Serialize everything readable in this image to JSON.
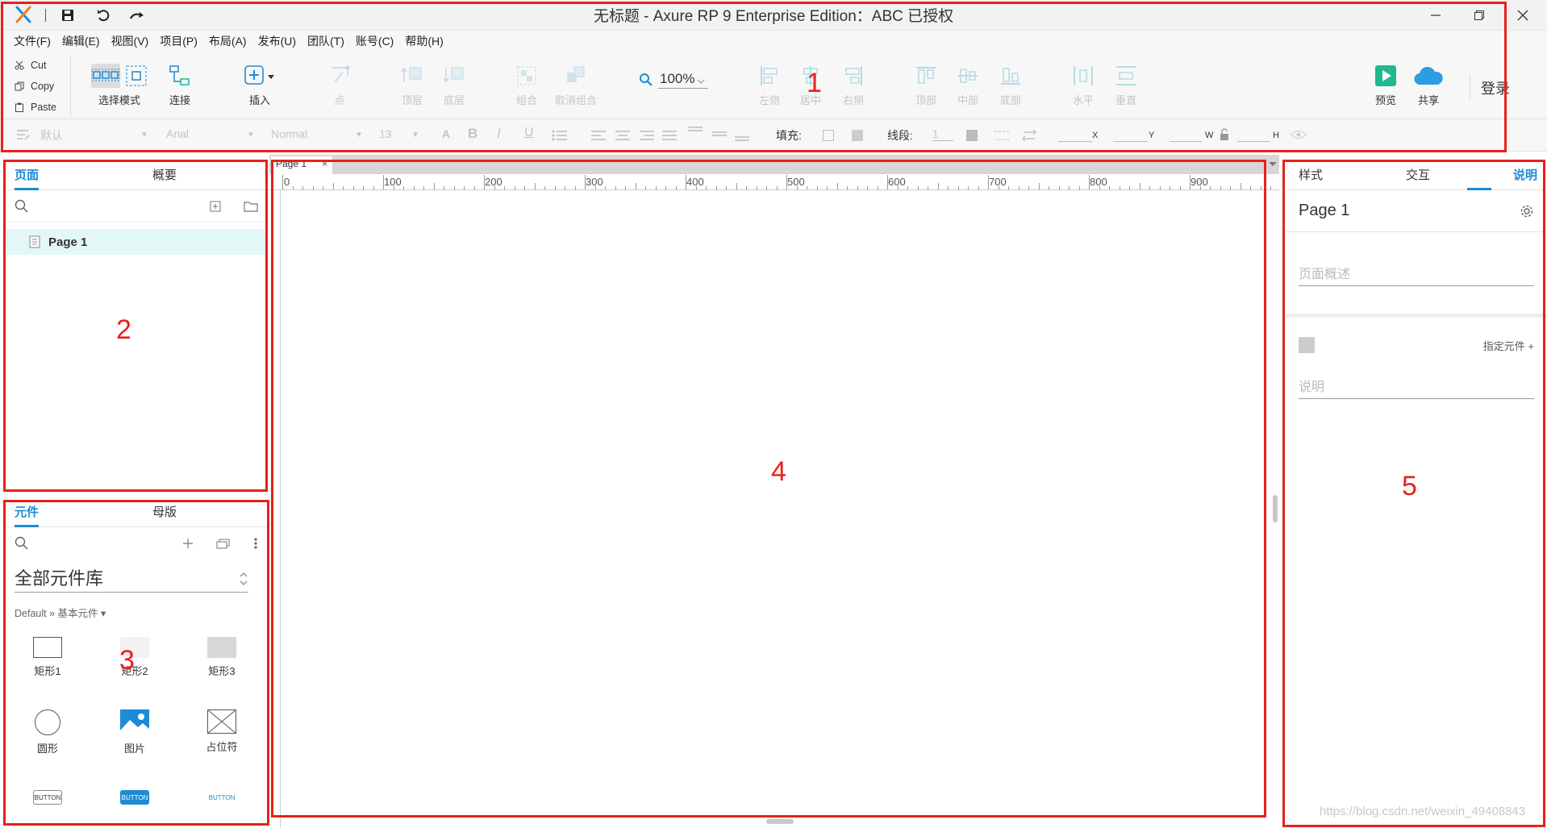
{
  "window": {
    "title": "无标题 - Axure RP 9 Enterprise Edition：ABC 已授权"
  },
  "menu": [
    "文件(F)",
    "编辑(E)",
    "视图(V)",
    "项目(P)",
    "布局(A)",
    "发布(U)",
    "团队(T)",
    "账号(C)",
    "帮助(H)"
  ],
  "clipboard": {
    "cut": "Cut",
    "copy": "Copy",
    "paste": "Paste"
  },
  "toolbar": {
    "select_mode": "选择模式",
    "connect": "连接",
    "insert": "插入",
    "point": "点",
    "top_layer": "顶层",
    "bottom_layer": "底层",
    "group": "组合",
    "ungroup": "取消组合",
    "zoom": "100%",
    "align_left": "左侧",
    "align_center": "居中",
    "align_right": "右侧",
    "align_top": "顶部",
    "align_middle": "中部",
    "align_bottom": "底部",
    "dist_h": "水平",
    "dist_v": "垂直",
    "preview": "预览",
    "share": "共享",
    "login": "登录"
  },
  "format": {
    "style": "默认",
    "font": "Arial",
    "weight": "Normal",
    "size": "13",
    "fill_label": "填充:",
    "stroke_label": "线段:",
    "stroke_value": "1",
    "x": "X",
    "y": "Y",
    "w": "W",
    "h": "H"
  },
  "pages_panel": {
    "tab_pages": "页面",
    "tab_outline": "概要",
    "pages": [
      "Page 1"
    ]
  },
  "widgets_panel": {
    "tab_libraries": "元件",
    "tab_masters": "母版",
    "library_select": "全部元件库",
    "breadcrumb": "Default » 基本元件 ▾",
    "items": [
      "矩形1",
      "矩形2",
      "矩形3",
      "圆形",
      "图片",
      "占位符"
    ],
    "button_text": "BUTTON"
  },
  "canvas": {
    "tab": "Page 1",
    "ruler": [
      "0",
      "100",
      "200",
      "300",
      "400",
      "500",
      "600",
      "700",
      "800",
      "900"
    ]
  },
  "inspector": {
    "tab_style": "样式",
    "tab_interactions": "交互",
    "tab_notes": "说明",
    "page_name": "Page 1",
    "page_summary_placeholder": "页面概述",
    "assign_widget": "指定元件 +",
    "notes_placeholder": "说明"
  },
  "annotations": [
    "1",
    "2",
    "3",
    "4",
    "5"
  ],
  "watermark": "https://blog.csdn.net/weixin_49408843",
  "colors": {
    "accent": "#1d8bd6",
    "annotation": "#e8201b",
    "preview": "#1fb88f"
  }
}
